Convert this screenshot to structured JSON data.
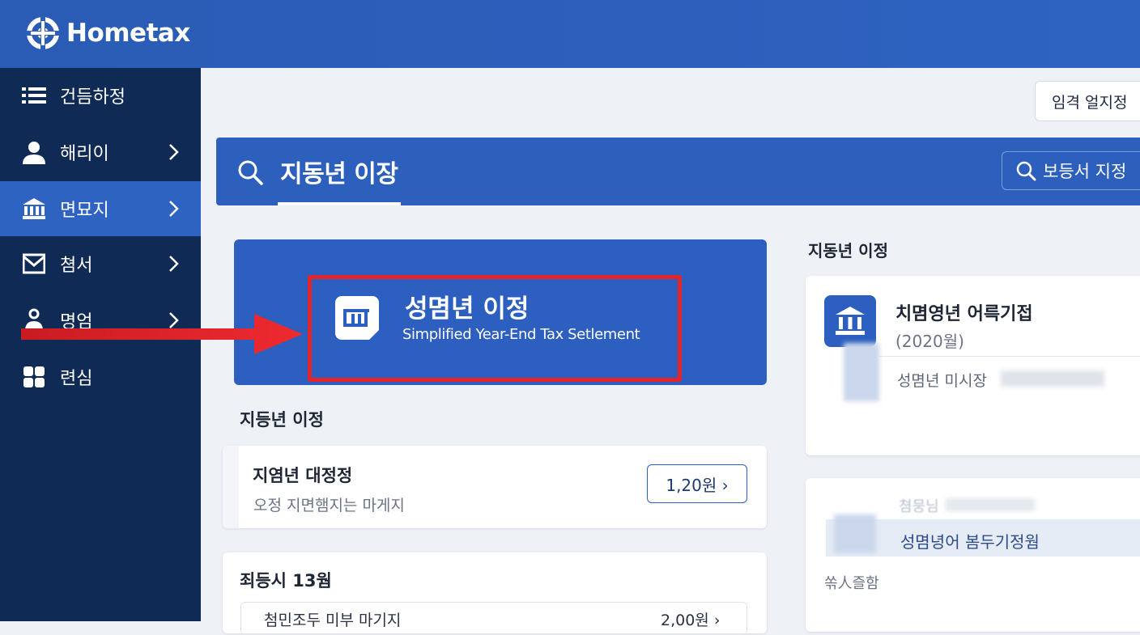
{
  "header": {
    "logo_text": "Hometax"
  },
  "sidebar": {
    "items": [
      {
        "label": "건듬하정",
        "icon": "list-icon",
        "chevron": false,
        "active": false
      },
      {
        "label": "해리이",
        "icon": "user-icon",
        "chevron": true,
        "active": false
      },
      {
        "label": "면묘지",
        "icon": "bank-icon",
        "chevron": true,
        "active": true
      },
      {
        "label": "쳠서",
        "icon": "mail-icon",
        "chevron": true,
        "active": false
      },
      {
        "label": "명엄",
        "icon": "support-icon",
        "chevron": true,
        "active": false
      },
      {
        "label": "련심",
        "icon": "grid-icon",
        "chevron": false,
        "active": false
      }
    ]
  },
  "top_button": {
    "label": "임격 얼지정"
  },
  "search": {
    "title": "지동년 이장",
    "doc_button_label": "보등서 지정"
  },
  "hero": {
    "title": "성몀년 이정",
    "subtitle": "Simplified Year-End Tax Setlement"
  },
  "left_section": {
    "label": "지등년 이정",
    "card1": {
      "title": "지염년 대정정",
      "subtitle": "오정 지면햄지는 마게지",
      "amount": "1,20원 ›"
    },
    "card2": {
      "title": "죄등시 13웜",
      "row_label": "첨민조두 미부 마기지",
      "row_amount": "2,00원 ›"
    }
  },
  "right_section": {
    "label": "지동년 이정",
    "card1": {
      "title": "치몀영년 어륵기접",
      "year": "(2020월)",
      "row": "성몀년 미시장"
    },
    "card2": {
      "faded": "쳠뭉님",
      "row": "성몀녕어 봄두기정웜",
      "footer": "쏚人즐함"
    }
  },
  "colors": {
    "brand_blue": "#2c5fc0",
    "sidebar_navy": "#0f2a54",
    "highlight_red": "#e3242b"
  }
}
